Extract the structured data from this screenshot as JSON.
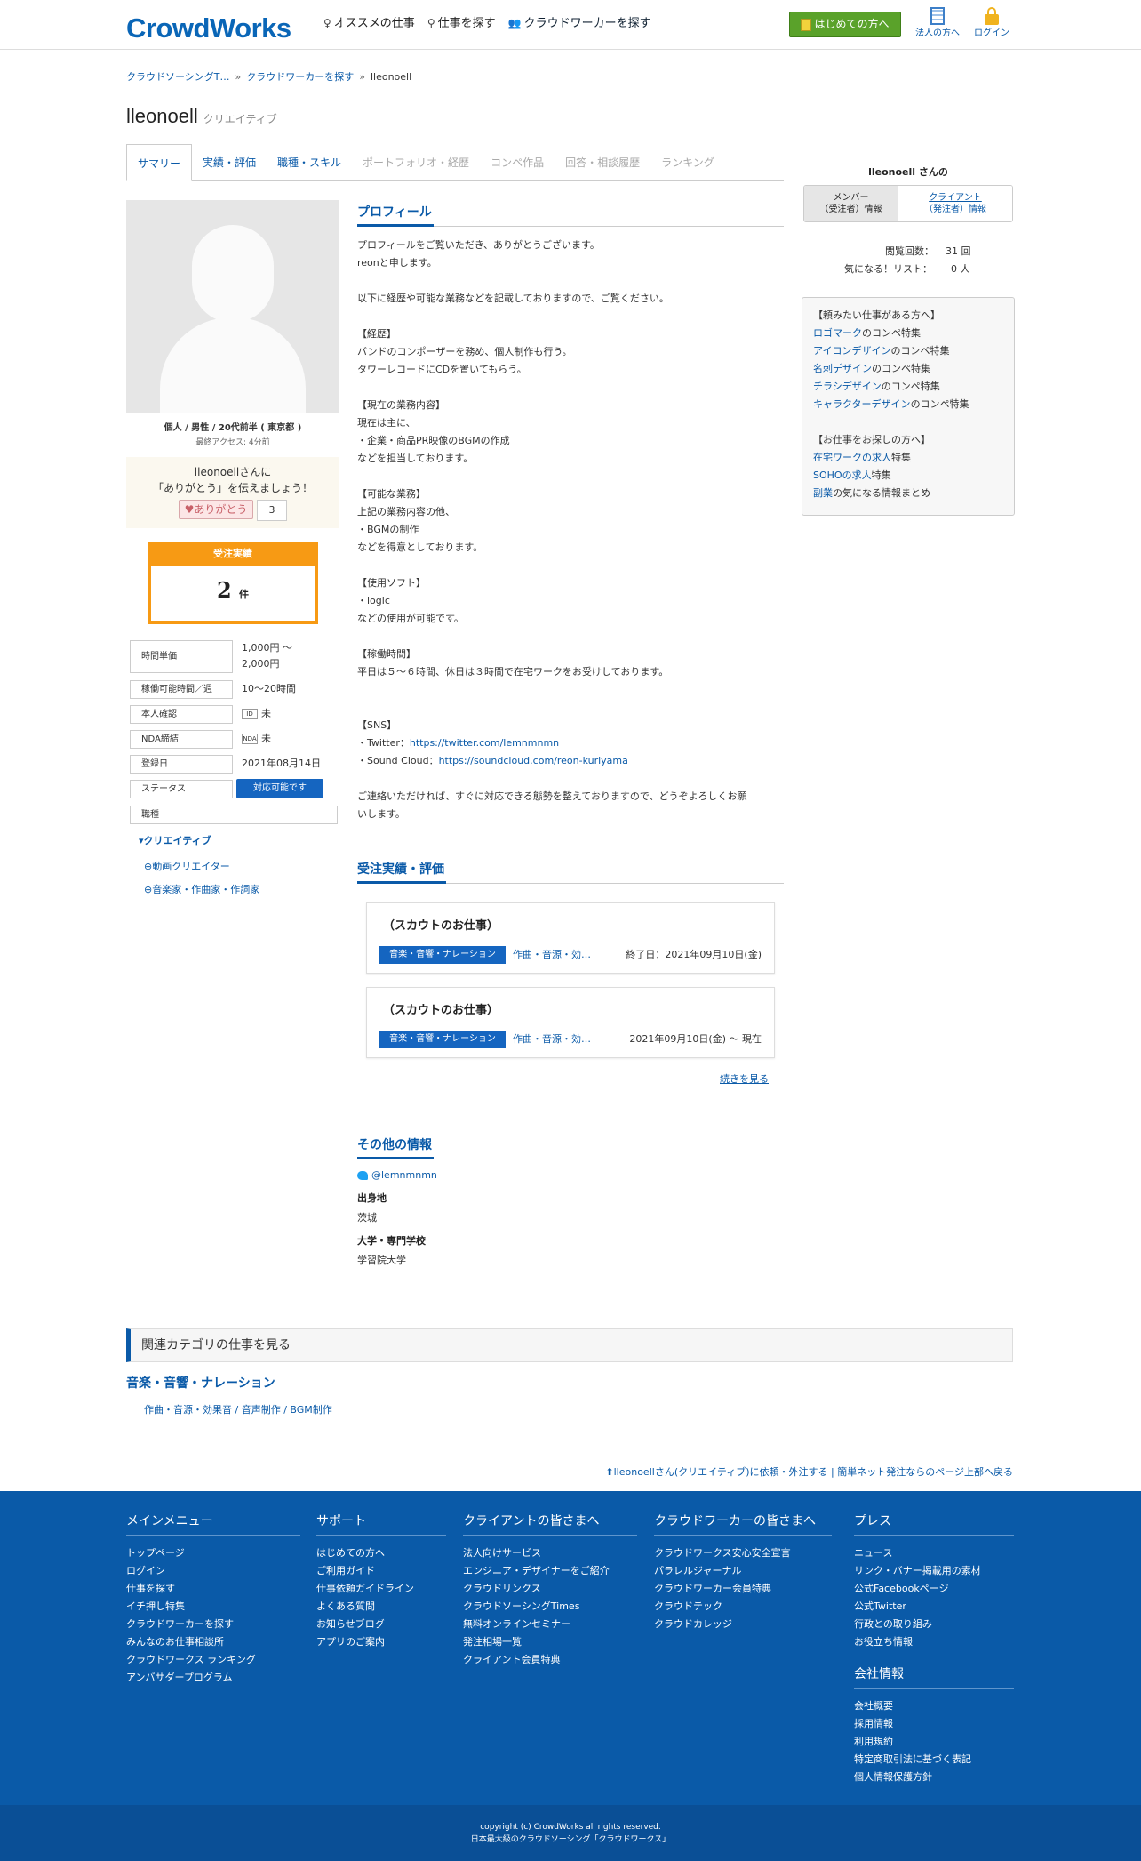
{
  "header": {
    "logo": "CrowdWorks",
    "nav": [
      "オススメの仕事",
      "仕事を探す",
      "クラウドワーカーを探す"
    ],
    "start_button": "はじめての方へ",
    "corp_link": "法人の方へ",
    "login_link": "ログイン"
  },
  "breadcrumb": [
    "クラウドソーシングT…",
    "クラウドワーカーを探す",
    "lleonoell"
  ],
  "profile": {
    "name": "lleonoell",
    "category": "クリエイティブ",
    "tabs": [
      "サマリー",
      "実績・評価",
      "職種・スキル",
      "ポートフォリオ・経歴",
      "コンペ作品",
      "回答・相談履歴",
      "ランキング"
    ],
    "user_info": "個人 / 男性 / 20代前半 ( 東京都 )",
    "last_access": "最終アクセス: 4分前",
    "thanks_line1": "lleonoellさんに",
    "thanks_line2": "「ありがとう」を伝えましょう！",
    "thanks_button": "ありがとう",
    "thanks_count": "3",
    "order_label": "受注実績",
    "order_count": "2",
    "order_unit": "件",
    "attrs": [
      {
        "label": "時間単価",
        "value": "1,000円 〜",
        "value2": "2,000円"
      },
      {
        "label": "稼働可能時間／週",
        "value": "10〜20時間"
      },
      {
        "label": "本人確認",
        "value": "未"
      },
      {
        "label": "NDA締結",
        "value": "未"
      },
      {
        "label": "登録日",
        "value": "2021年08月14日"
      },
      {
        "label": "ステータス",
        "value": "対応可能です"
      },
      {
        "label": "職種",
        "value": ""
      }
    ],
    "job_category": "クリエイティブ",
    "job_subs": [
      "動画クリエイター",
      "音楽家・作曲家・作詞家"
    ]
  },
  "main": {
    "profile_heading": "プロフィール",
    "profile_lines": [
      "プロフィールをご覧いただき、ありがとうございます。",
      "reonと申します。",
      "",
      "以下に経歴や可能な業務などを記載しておりますので、ご覧ください。",
      "",
      "【経歴】",
      "バンドのコンポーザーを務め、個人制作も行う。",
      "タワーレコードにCDを置いてもらう。",
      "",
      "【現在の業務内容】",
      "現在は主に、",
      "・企業・商品PR映像のBGMの作成",
      "などを担当しております。",
      "",
      "【可能な業務】",
      "上記の業務内容の他、",
      "・BGMの制作",
      "などを得意としております。",
      "",
      "【使用ソフト】",
      "・logic",
      "などの使用が可能です。",
      "",
      "【稼働時間】",
      "平日は５～６時間、休日は３時間で在宅ワークをお受けしております。",
      "",
      "",
      "【SNS】"
    ],
    "sns_twitter_label": "・Twitter：",
    "sns_twitter_url": "https://twitter.com/lemnmnmn",
    "sns_sound_label": "・Sound Cloud：",
    "sns_sound_url": "https://soundcloud.com/reon-kuriyama",
    "closing_1": "ご連絡いただければ、すぐに対応できる態勢を整えておりますので、どうぞよろしくお願",
    "closing_2": "いします。",
    "orders_heading": "受注実績・評価",
    "orders": [
      {
        "title": "（スカウトのお仕事）",
        "category": "音楽・音響・ナレーション",
        "sub": "作曲・音源・効…",
        "date": "終了日：2021年09月10日(金)"
      },
      {
        "title": "（スカウトのお仕事）",
        "category": "音楽・音響・ナレーション",
        "sub": "作曲・音源・効…",
        "date": "2021年09月10日(金) 〜 現在"
      }
    ],
    "more_link": "続きを見る",
    "other_heading": "その他の情報",
    "twitter_handle": "@lemnmnmn",
    "birthplace_label": "出身地",
    "birthplace": "茨城",
    "school_label": "大学・専門学校",
    "school": "学習院大学"
  },
  "sidebar": {
    "title": "lleonoell さんの",
    "member_tab": "メンバー\n（受注者）情報",
    "client_tab": "クライアント\n（発注者）情報",
    "views_label": "閲覧回数：",
    "views": "31 回",
    "fav_label": "気になる！リスト：",
    "fav": "0 人",
    "box_head1": "【頼みたい仕事がある方へ】",
    "box_items1": [
      {
        "link": "ロゴマーク",
        "rest": "のコンペ特集"
      },
      {
        "link": "アイコンデザイン",
        "rest": "のコンペ特集"
      },
      {
        "link": "名刺デザイン",
        "rest": "のコンペ特集"
      },
      {
        "link": "チラシデザイン",
        "rest": "のコンペ特集"
      },
      {
        "link": "キャラクターデザイン",
        "rest": "のコンペ特集"
      }
    ],
    "box_head2": "【お仕事をお探しの方へ】",
    "box_items2": [
      {
        "link": "在宅ワークの求人",
        "rest": "特集"
      },
      {
        "link": "SOHOの求人",
        "rest": "特集"
      },
      {
        "link": "副業",
        "rest": "の気になる情報まとめ"
      }
    ]
  },
  "related": {
    "heading": "関連カテゴリの仕事を見る",
    "category": "音楽・音響・ナレーション",
    "sub": "作曲・音源・効果音 / 音声制作 / BGM制作",
    "back_text": "lleonoellさん(クリエイティブ)に依頼・外注する | 簡単ネット発注ならのページ上部へ戻る"
  },
  "footer": {
    "columns": [
      {
        "heading": "メインメニュー",
        "items": [
          "トップページ",
          "ログイン",
          "仕事を探す",
          "イチ押し特集",
          "クラウドワーカーを探す",
          "みんなのお仕事相談所",
          "クラウドワークス ランキング",
          "アンバサダープログラム"
        ]
      },
      {
        "heading": "サポート",
        "items": [
          "はじめての方へ",
          "ご利用ガイド",
          "仕事依頼ガイドライン",
          "よくある質問",
          "お知らせブログ",
          "アプリのご案内"
        ]
      },
      {
        "heading": "クライアントの皆さまへ",
        "items": [
          "法人向けサービス",
          "エンジニア・デザイナーをご紹介",
          "クラウドリンクス",
          "クラウドソーシングTimes",
          "無料オンラインセミナー",
          "発注相場一覧",
          "クライアント会員特典"
        ]
      },
      {
        "heading": "クラウドワーカーの皆さまへ",
        "items": [
          "クラウドワークス安心安全宣言",
          "パラレルジャーナル",
          "クラウドワーカー会員特典",
          "クラウドテック",
          "クラウドカレッジ"
        ]
      },
      {
        "heading": "プレス",
        "items": [
          "ニュース",
          "リンク・バナー掲載用の素材",
          "公式Facebookページ",
          "公式Twitter",
          "行政との取り組み",
          "お役立ち情報"
        ]
      }
    ],
    "company_heading": "会社情報",
    "company_items": [
      "会社概要",
      "採用情報",
      "利用規約",
      "特定商取引法に基づく表記",
      "個人情報保護方針"
    ],
    "copyright": "copyright (c) CrowdWorks all rights reserved.",
    "tagline": "日本最大級のクラウドソーシング「クラウドワークス」"
  }
}
